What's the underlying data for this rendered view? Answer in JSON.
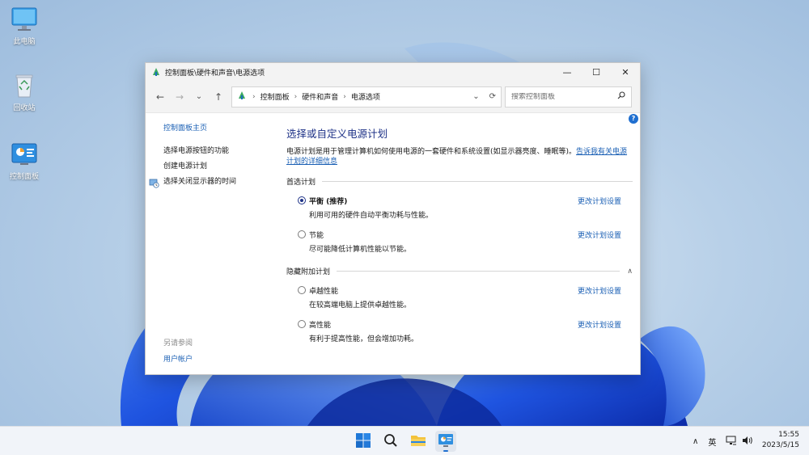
{
  "desktop": {
    "icons": [
      {
        "label": "此电脑",
        "icon": "monitor-icon"
      },
      {
        "label": "回收站",
        "icon": "recycle-bin-icon"
      },
      {
        "label": "控制面板",
        "icon": "control-panel-icon"
      }
    ]
  },
  "window": {
    "title": "控制面板\\硬件和声音\\电源选项",
    "controls": {
      "minimize": "—",
      "maximize": "☐",
      "close": "✕"
    },
    "nav": {
      "back": "←",
      "forward": "→",
      "recent": "⌄",
      "up": "↑"
    },
    "breadcrumb": [
      "控制面板",
      "硬件和声音",
      "电源选项"
    ],
    "search_placeholder": "搜索控制面板"
  },
  "leftpane": {
    "home": "控制面板主页",
    "tasks": [
      "选择电源按钮的功能",
      "创建电源计划",
      "选择关闭显示器的时间"
    ],
    "see_also_header": "另请参阅",
    "see_also_links": [
      "用户帐户"
    ]
  },
  "main": {
    "heading": "选择或自定义电源计划",
    "intro_text": "电源计划是用于管理计算机如何使用电源的一套硬件和系统设置(如显示器亮度、睡眠等)。",
    "intro_link": "告诉我有关电源计划的详细信息",
    "preferred_header": "首选计划",
    "hidden_header": "隐藏附加计划",
    "change_label": "更改计划设置",
    "preferred_plans": [
      {
        "name": "平衡 (推荐)",
        "desc": "利用可用的硬件自动平衡功耗与性能。",
        "selected": true
      },
      {
        "name": "节能",
        "desc": "尽可能降低计算机性能以节能。",
        "selected": false
      }
    ],
    "hidden_plans": [
      {
        "name": "卓越性能",
        "desc": "在较高端电脑上提供卓越性能。",
        "selected": false
      },
      {
        "name": "高性能",
        "desc": "有利于提高性能，但会增加功耗。",
        "selected": false
      }
    ]
  },
  "taskbar": {
    "apps": [
      "start-icon",
      "search-icon",
      "file-explorer-icon",
      "control-panel-icon"
    ],
    "tray_chevron": "∧",
    "ime": "英",
    "time": "15:55",
    "date": "2023/5/15"
  },
  "colors": {
    "accent": "#1e3287",
    "link": "#1a5fb4",
    "wallpaper_bloom": "#1d4fd8"
  }
}
